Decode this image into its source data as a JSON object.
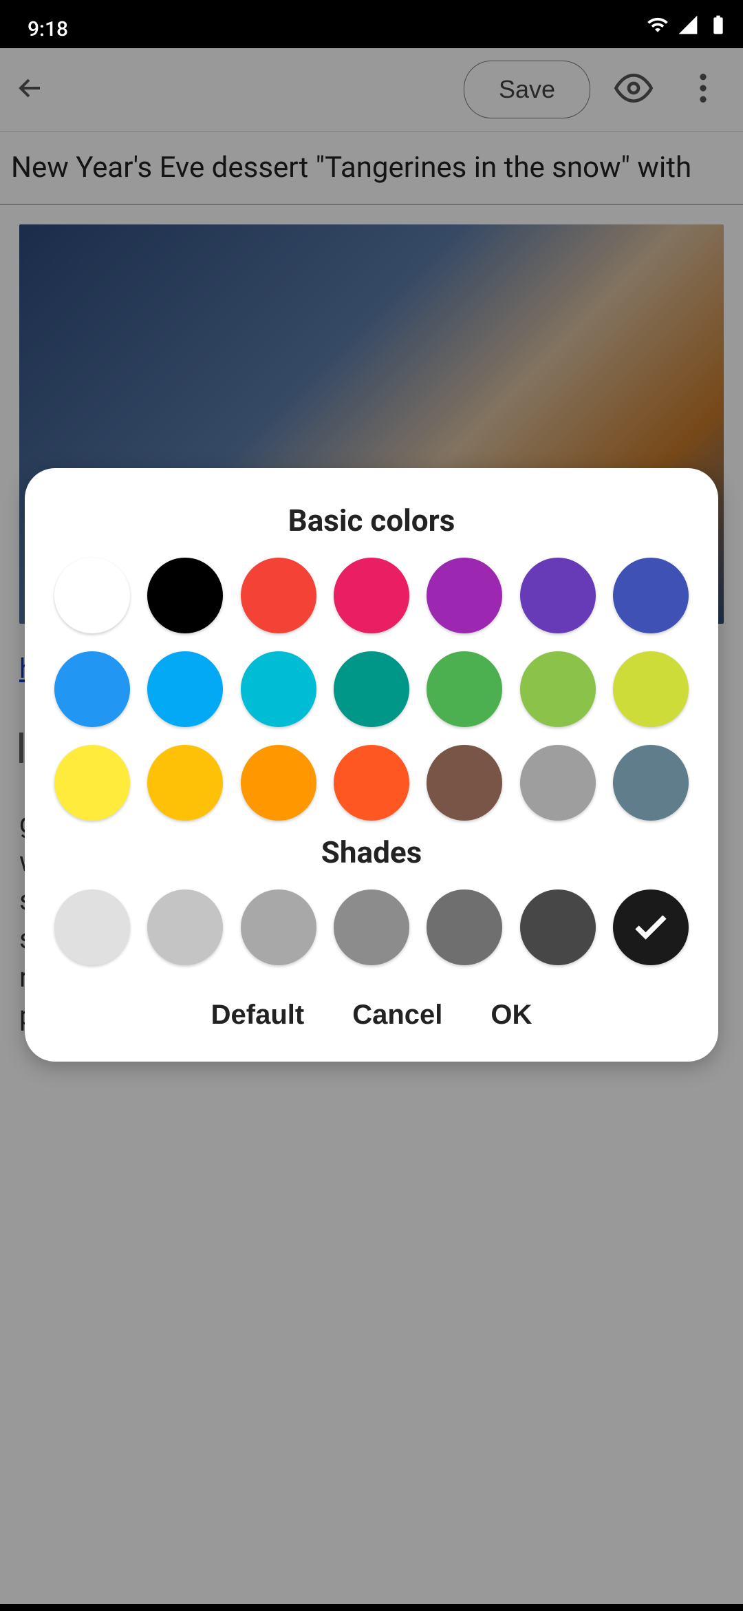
{
  "status": {
    "time": "9:18",
    "icons": [
      "wifi",
      "signal",
      "battery"
    ]
  },
  "toolbar": {
    "back_icon": "arrow-back",
    "save_label": "Save",
    "preview_icon": "eye",
    "more_icon": "more-vert"
  },
  "title_field": "New Year's Eve dessert \"Tangerines in the snow\" with",
  "body": {
    "link_fragment": "h",
    "para1_prefix": "g",
    "para1_rest": "w",
    "lines": [
      "s",
      "s",
      "r",
      "p"
    ]
  },
  "dialog": {
    "section1_title": "Basic colors",
    "section2_title": "Shades",
    "basic_colors": [
      {
        "hex": "#ffffff",
        "name": "white",
        "bordered": true
      },
      {
        "hex": "#000000",
        "name": "black"
      },
      {
        "hex": "#f44336",
        "name": "red"
      },
      {
        "hex": "#e91e63",
        "name": "pink"
      },
      {
        "hex": "#9c27b0",
        "name": "purple"
      },
      {
        "hex": "#673ab7",
        "name": "deep-purple"
      },
      {
        "hex": "#3f51b5",
        "name": "indigo"
      },
      {
        "hex": "#2196f3",
        "name": "blue"
      },
      {
        "hex": "#03a9f4",
        "name": "light-blue"
      },
      {
        "hex": "#00bcd4",
        "name": "cyan"
      },
      {
        "hex": "#009688",
        "name": "teal"
      },
      {
        "hex": "#4caf50",
        "name": "green"
      },
      {
        "hex": "#8bc34a",
        "name": "light-green"
      },
      {
        "hex": "#cddc39",
        "name": "lime"
      },
      {
        "hex": "#ffeb3b",
        "name": "yellow"
      },
      {
        "hex": "#ffc107",
        "name": "amber"
      },
      {
        "hex": "#ff9800",
        "name": "orange"
      },
      {
        "hex": "#ff5722",
        "name": "deep-orange"
      },
      {
        "hex": "#795548",
        "name": "brown"
      },
      {
        "hex": "#9e9e9e",
        "name": "gray"
      },
      {
        "hex": "#607d8b",
        "name": "blue-gray"
      }
    ],
    "shades": [
      {
        "hex": "#e0e0e0",
        "name": "shade-1"
      },
      {
        "hex": "#c4c4c4",
        "name": "shade-2"
      },
      {
        "hex": "#a8a8a8",
        "name": "shade-3"
      },
      {
        "hex": "#8c8c8c",
        "name": "shade-4"
      },
      {
        "hex": "#6f6f6f",
        "name": "shade-5"
      },
      {
        "hex": "#474747",
        "name": "shade-6"
      },
      {
        "hex": "#1a1a1a",
        "name": "shade-7",
        "selected": true
      }
    ],
    "btn_default": "Default",
    "btn_cancel": "Cancel",
    "btn_ok": "OK"
  }
}
